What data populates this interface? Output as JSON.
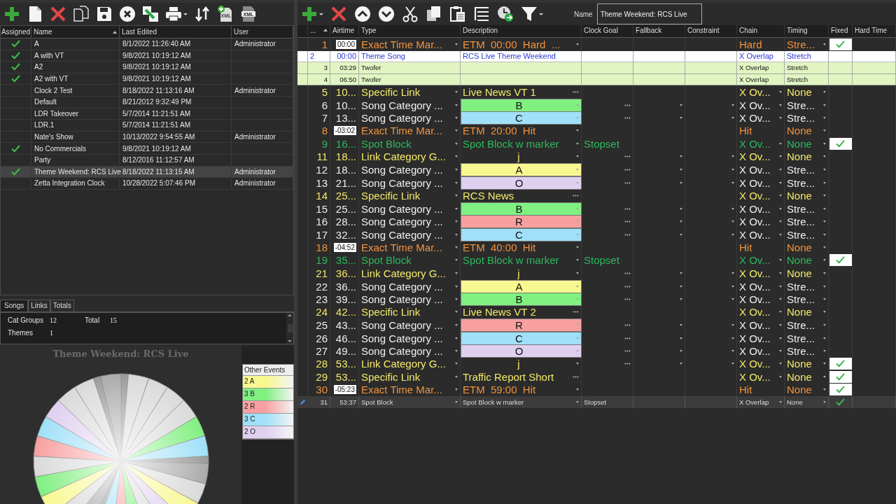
{
  "left_toolbar": [
    {
      "kind": "add"
    },
    {
      "kind": "new"
    },
    {
      "kind": "delete"
    },
    {
      "kind": "copy"
    },
    {
      "kind": "save"
    },
    {
      "kind": "cancel"
    },
    {
      "kind": "import"
    },
    {
      "kind": "print",
      "has_menu": true
    },
    {
      "kind": "swap"
    },
    {
      "kind": "xml-add",
      "label": "XML"
    },
    {
      "kind": "xml",
      "label": "XML"
    }
  ],
  "clocks": {
    "columns": [
      "Assigned",
      "Name",
      "Last Edited",
      "User"
    ],
    "rows": [
      {
        "assigned": true,
        "name": "A",
        "last_edited": "8/1/2022 11:26:40 AM",
        "user": "Administrator",
        "selected": false
      },
      {
        "assigned": true,
        "name": "A with VT",
        "last_edited": "9/8/2021 10:19:12 AM",
        "selected": false
      },
      {
        "assigned": true,
        "name": "A2",
        "last_edited": "9/8/2021 10:19:12 AM",
        "selected": false
      },
      {
        "assigned": true,
        "name": "A2 with VT",
        "last_edited": "9/8/2021 10:19:12 AM",
        "selected": false
      },
      {
        "assigned": false,
        "name": "Clock 2 Test",
        "last_edited": "8/18/2022 11:13:16 AM",
        "user": "Administrator",
        "selected": false
      },
      {
        "assigned": false,
        "name": "Default",
        "last_edited": "8/21/2012 9:32:49 PM",
        "selected": false
      },
      {
        "assigned": false,
        "name": "LDR Takeover",
        "last_edited": "5/7/2014 11:21:51 AM",
        "selected": false
      },
      {
        "assigned": false,
        "name": "LDR.1",
        "last_edited": "5/7/2014 11:21:51 AM",
        "selected": false
      },
      {
        "assigned": false,
        "name": "Nate's Show",
        "last_edited": "10/13/2022 9:54:55 AM",
        "user": "Administrator",
        "selected": false
      },
      {
        "assigned": true,
        "name": "No Commercials",
        "last_edited": "9/8/2021 10:19:12 AM",
        "selected": false
      },
      {
        "assigned": false,
        "name": "Party",
        "last_edited": "8/12/2016 11:12:57 AM",
        "selected": false
      },
      {
        "assigned": true,
        "name": "Theme Weekend: RCS Live",
        "last_edited": "8/18/2022 11:13:15 AM",
        "user": "Administrator",
        "selected": true
      },
      {
        "assigned": false,
        "name": "Zetta Integration Clock",
        "last_edited": "10/28/2022 5:07:46 PM",
        "user": "Administrator",
        "selected": false
      }
    ]
  },
  "tabs": [
    {
      "label": "Songs",
      "selected": true
    },
    {
      "label": "Links",
      "selected": false
    },
    {
      "label": "Totals",
      "selected": false
    }
  ],
  "stats": [
    {
      "label": "Cat Groups",
      "value": "12"
    },
    {
      "label": "Total",
      "value": "15"
    },
    {
      "label": "Themes",
      "value": "1"
    }
  ],
  "chart": {
    "title": "Theme Weekend: RCS Live",
    "legend_title": "Other Events",
    "legend": [
      {
        "label": "2 A",
        "color": "#f8f890"
      },
      {
        "label": "3 B",
        "color": "#80f080"
      },
      {
        "label": "2 R",
        "color": "#f8a0a0"
      },
      {
        "label": "3 C",
        "color": "#a0e0f8"
      },
      {
        "label": "2 O",
        "color": "#e0d0f0"
      }
    ]
  },
  "right_toolbar": [
    {
      "kind": "add",
      "has_menu": true
    },
    {
      "kind": "delete"
    },
    {
      "kind": "up"
    },
    {
      "kind": "down"
    },
    {
      "kind": "cut"
    },
    {
      "kind": "copy"
    },
    {
      "kind": "paste"
    },
    {
      "kind": "tree"
    },
    {
      "kind": "clock"
    },
    {
      "kind": "filter",
      "has_menu": true
    }
  ],
  "name_field": {
    "label": "Name",
    "value": "Theme Weekend: RCS Live"
  },
  "events": {
    "columns": [
      "...",
      "Airtime",
      "Type",
      "Description",
      "Clock Goal",
      "Fallback",
      "Constraint",
      "Chain",
      "Timing",
      "Fixed",
      "Hard Time"
    ],
    "rows": [
      {
        "n": "1",
        "kind": "etm",
        "airtime": "00:00",
        "type": "Exact Time Mar...",
        "description": "ETM  00:00  Hard  ...",
        "chain": "Hard",
        "timing": "Stre...",
        "fixed": true,
        "selected": false
      },
      {
        "n": "2",
        "kind": "theme",
        "airtime": "00:00",
        "type": "Theme Song",
        "description": "RCS Live Theme Weekend",
        "chain": "X Overlap",
        "timing": "Stretch",
        "fixed": false,
        "selected": false
      },
      {
        "n": "3",
        "kind": "twofer",
        "airtime": "03:29",
        "type": "Twofer",
        "chain": "X Overlap",
        "timing": "Stretch",
        "fixed": false,
        "selected": false
      },
      {
        "n": "4",
        "kind": "twofer",
        "airtime": "06:50",
        "type": "Twofer",
        "chain": "X Overlap",
        "timing": "Stretch",
        "fixed": false,
        "selected": false
      },
      {
        "n": "5",
        "kind": "link",
        "airtime": "10...",
        "type": "Specific Link",
        "description": "Live News VT 1",
        "chain": "X Ov...",
        "timing": "None",
        "fixed": false,
        "selected": false
      },
      {
        "n": "6",
        "kind": "song",
        "airtime": "10...",
        "type": "Song Category ...",
        "description": "B",
        "color": "#80f080",
        "chain": "X Ov...",
        "timing": "Stre...",
        "fixed": false,
        "selected": false
      },
      {
        "n": "7",
        "kind": "song",
        "airtime": "13...",
        "type": "Song Category ...",
        "description": "C",
        "color": "#a0e0f8",
        "chain": "X Ov...",
        "timing": "Stre...",
        "fixed": false,
        "selected": false
      },
      {
        "n": "8",
        "kind": "etm",
        "airtime": "-03:02",
        "type": "Exact Time Mar...",
        "description": "ETM  20:00  Hit",
        "chain": "Hit",
        "timing": "None",
        "fixed": false,
        "selected": false
      },
      {
        "n": "9",
        "kind": "spot",
        "airtime": "16...",
        "type": "Spot Block",
        "description": "Spot Block w marker",
        "clock_goal": "Stopset",
        "chain": "X Ov...",
        "timing": "None",
        "fixed": true,
        "selected": false
      },
      {
        "n": "11",
        "kind": "linkcat",
        "airtime": "18...",
        "type": "Link Category G...",
        "description": "j",
        "chain": "X Ov...",
        "timing": "None",
        "fixed": false,
        "selected": false
      },
      {
        "n": "12",
        "kind": "song",
        "airtime": "18...",
        "type": "Song Category ...",
        "description": "A",
        "color": "#f8f890",
        "chain": "X Ov...",
        "timing": "Stre...",
        "fixed": false,
        "selected": false
      },
      {
        "n": "13",
        "kind": "song",
        "airtime": "21...",
        "type": "Song Category ...",
        "description": "O",
        "color": "#e0d0f0",
        "chain": "X Ov...",
        "timing": "Stre...",
        "fixed": false,
        "selected": false
      },
      {
        "n": "14",
        "kind": "link",
        "airtime": "25...",
        "type": "Specific Link",
        "description": "RCS News",
        "chain": "X Ov...",
        "timing": "None",
        "fixed": false,
        "selected": false
      },
      {
        "n": "15",
        "kind": "song",
        "airtime": "25...",
        "type": "Song Category ...",
        "description": "B",
        "color": "#80f080",
        "chain": "X Ov...",
        "timing": "Stre...",
        "fixed": false,
        "selected": false
      },
      {
        "n": "16",
        "kind": "song",
        "airtime": "28...",
        "type": "Song Category ...",
        "description": "R",
        "color": "#f8a0a0",
        "chain": "X Ov...",
        "timing": "Stre...",
        "fixed": false,
        "selected": false
      },
      {
        "n": "17",
        "kind": "song",
        "airtime": "32...",
        "type": "Song Category ...",
        "description": "C",
        "color": "#a0e0f8",
        "chain": "X Ov...",
        "timing": "Stre...",
        "fixed": false,
        "selected": false
      },
      {
        "n": "18",
        "kind": "etm",
        "airtime": "-04:52",
        "type": "Exact Time Mar...",
        "description": "ETM  40:00  Hit",
        "chain": "Hit",
        "timing": "None",
        "fixed": false,
        "selected": false
      },
      {
        "n": "19",
        "kind": "spot",
        "airtime": "35...",
        "type": "Spot Block",
        "description": "Spot Block w marker",
        "clock_goal": "Stopset",
        "chain": "X Ov...",
        "timing": "None",
        "fixed": true,
        "selected": false
      },
      {
        "n": "21",
        "kind": "linkcat",
        "airtime": "36...",
        "type": "Link Category G...",
        "description": "j",
        "chain": "X Ov...",
        "timing": "None",
        "fixed": false,
        "selected": false
      },
      {
        "n": "22",
        "kind": "song",
        "airtime": "36...",
        "type": "Song Category ...",
        "description": "A",
        "color": "#f8f890",
        "chain": "X Ov...",
        "timing": "Stre...",
        "fixed": false,
        "selected": false
      },
      {
        "n": "23",
        "kind": "song",
        "airtime": "39...",
        "type": "Song Category ...",
        "description": "B",
        "color": "#80f080",
        "chain": "X Ov...",
        "timing": "Stre...",
        "fixed": false,
        "selected": false
      },
      {
        "n": "24",
        "kind": "link",
        "airtime": "42...",
        "type": "Specific Link",
        "description": "Live News VT 2",
        "chain": "X Ov...",
        "timing": "None",
        "fixed": false,
        "selected": false
      },
      {
        "n": "25",
        "kind": "song",
        "airtime": "43...",
        "type": "Song Category ...",
        "description": "R",
        "color": "#f8a0a0",
        "chain": "X Ov...",
        "timing": "Stre...",
        "fixed": false,
        "selected": false
      },
      {
        "n": "26",
        "kind": "song",
        "airtime": "46...",
        "type": "Song Category ...",
        "description": "C",
        "color": "#a0e0f8",
        "chain": "X Ov...",
        "timing": "Stre...",
        "fixed": false,
        "selected": false
      },
      {
        "n": "27",
        "kind": "song",
        "airtime": "49...",
        "type": "Song Category ...",
        "description": "O",
        "color": "#e0d0f0",
        "chain": "X Ov...",
        "timing": "Stre...",
        "fixed": false,
        "selected": false
      },
      {
        "n": "28",
        "kind": "linkcat",
        "airtime": "53...",
        "type": "Link Category G...",
        "description": "j",
        "chain": "X Ov...",
        "timing": "None",
        "fixed": true,
        "selected": false
      },
      {
        "n": "29",
        "kind": "link",
        "airtime": "53...",
        "type": "Specific Link",
        "description": "Traffic Report Short",
        "chain": "X Ov...",
        "timing": "None",
        "fixed": true,
        "selected": false
      },
      {
        "n": "30",
        "kind": "etm",
        "airtime": "-05:23",
        "type": "Exact Time Mar...",
        "description": "ETM  59:00  Hit",
        "chain": "Hit",
        "timing": "None",
        "fixed": true,
        "selected": false
      },
      {
        "n": "31",
        "kind": "spot",
        "airtime": "53:37",
        "type": "Spot Block",
        "description": "Spot Block w marker",
        "clock_goal": "Stopset",
        "chain": "X Overlap",
        "timing": "None",
        "fixed": true,
        "selected": true
      }
    ]
  }
}
